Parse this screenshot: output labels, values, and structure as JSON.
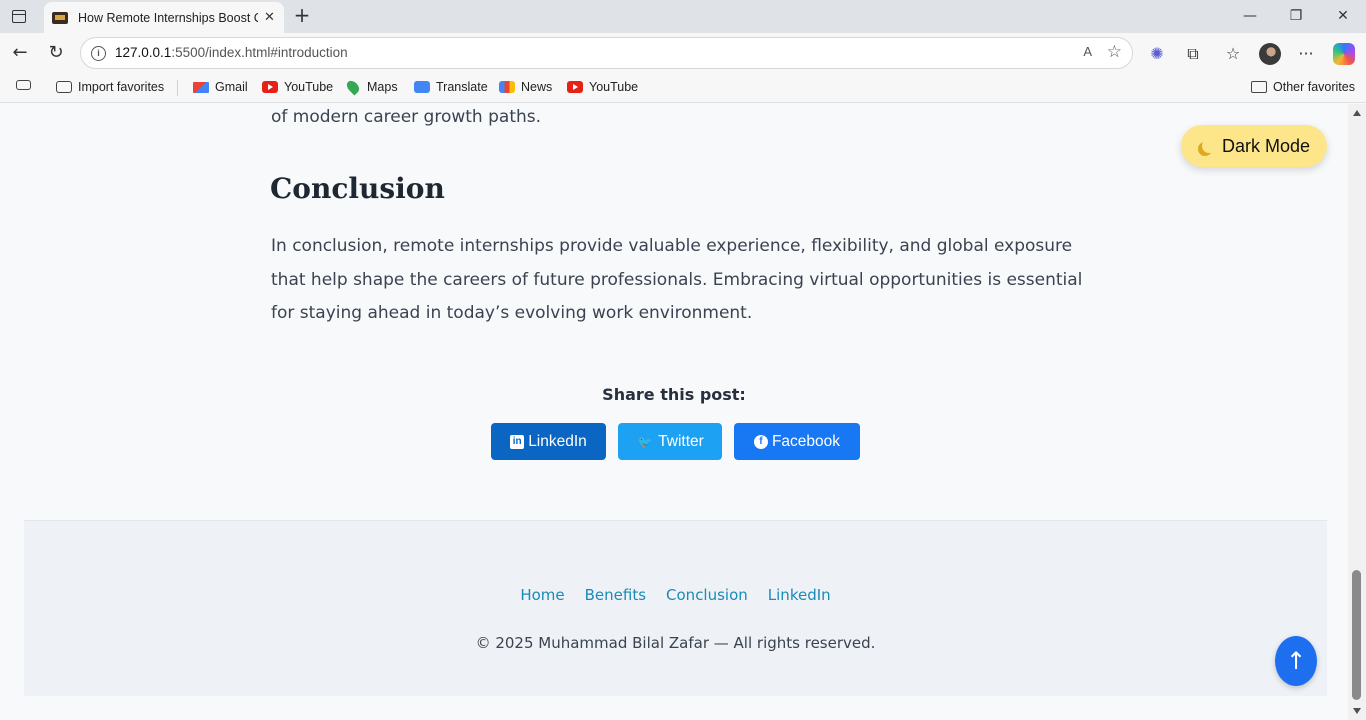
{
  "browser": {
    "tab_title": "How Remote Internships Boost Ca",
    "tab_close": "✕",
    "new_tab": "+",
    "window_controls": {
      "minimize": "—",
      "restore": "❐",
      "close": "✕"
    },
    "url_host": "127.0.0.1",
    "url_path": ":5500/index.html#introduction",
    "read_aloud": "A",
    "bookmarks": [
      {
        "label": "Import favorites",
        "icon": "import-icon"
      },
      {
        "label": "Gmail",
        "icon": "gmail-icon"
      },
      {
        "label": "YouTube",
        "icon": "youtube-icon"
      },
      {
        "label": "Maps",
        "icon": "maps-icon"
      },
      {
        "label": "Translate",
        "icon": "translate-icon"
      },
      {
        "label": "News",
        "icon": "news-icon"
      },
      {
        "label": "YouTube",
        "icon": "youtube-icon"
      }
    ],
    "other_favorites": "Other favorites"
  },
  "article": {
    "intro_tail": "of modern career growth paths.",
    "conclusion_heading": "Conclusion",
    "conclusion_text": "In conclusion, remote internships provide valuable experience, flexibility, and global exposure that help shape the careers of future professionals. Embracing virtual opportunities is essential for staying ahead in today’s evolving work environment."
  },
  "dark_mode": {
    "label": "Dark Mode",
    "icon": "moon-icon"
  },
  "share": {
    "label": "Share this post:",
    "buttons": [
      {
        "label": "LinkedIn",
        "icon_text": "in",
        "color": "#0a66c2"
      },
      {
        "label": "Twitter",
        "icon_text": "🐦",
        "color": "#1da1f2"
      },
      {
        "label": "Facebook",
        "icon_text": "f",
        "color": "#1877f2"
      }
    ]
  },
  "footer": {
    "links": [
      "Home",
      "Benefits",
      "Conclusion",
      "LinkedIn"
    ],
    "copyright": "© 2025 Muhammad Bilal Zafar — All rights reserved."
  },
  "back_to_top": {
    "label": "↑"
  },
  "colors": {
    "page_bg": "#f7f9fb",
    "footer_bg": "#eef2f6",
    "link": "#1a8ab8",
    "dark_toggle_bg": "#fde68a",
    "back_to_top_bg": "#1d6ff0"
  }
}
